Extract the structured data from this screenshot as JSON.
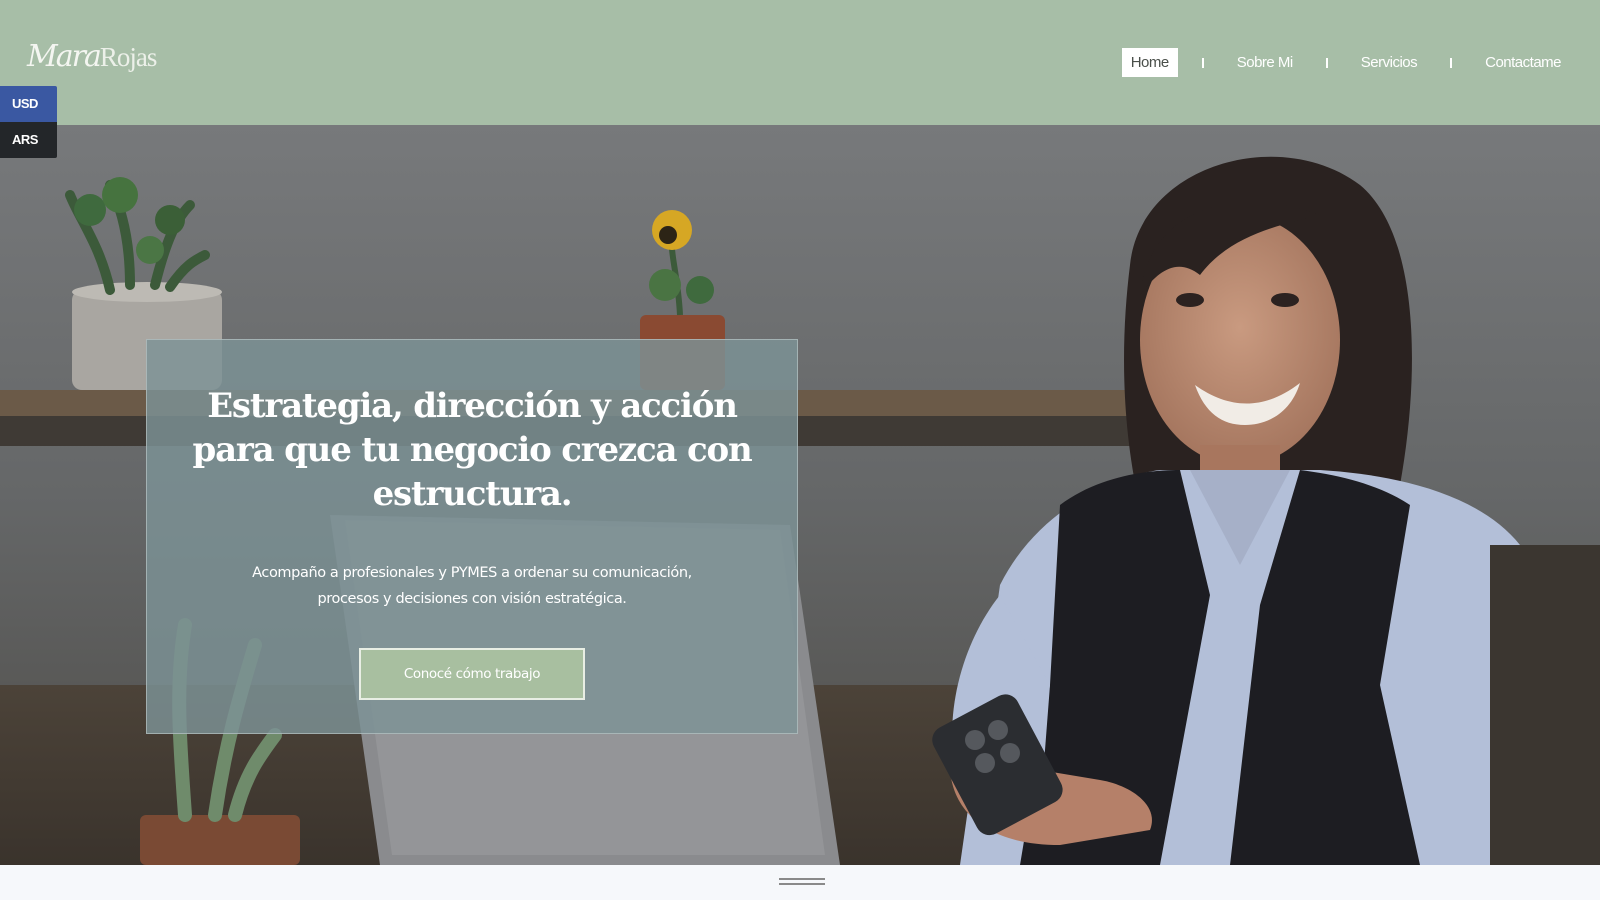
{
  "brand": {
    "logo_part1": "Mara",
    "logo_part2": "Rojas"
  },
  "nav": {
    "items": [
      {
        "label": "Home",
        "active": true
      },
      {
        "label": "Sobre Mi",
        "active": false
      },
      {
        "label": "Servicios",
        "active": false
      },
      {
        "label": "Contactame",
        "active": false
      }
    ]
  },
  "currency": {
    "usd": "USD",
    "ars": "ARS",
    "selected": "USD"
  },
  "hero": {
    "title": "Estrategia, dirección y acción para que tu negocio crezca con estructura.",
    "subtitle": "Acompaño a profesionales y PYMES a ordenar su comunicación, procesos y decisiones con visión estratégica.",
    "cta_label": "Conocé cómo trabajo"
  },
  "colors": {
    "header_bg": "#a7bea7",
    "usd_bg": "#3a58a2",
    "ars_bg": "#232629",
    "card_bg": "#7c9296",
    "cta_bg": "#a8bfa0"
  },
  "icons": {
    "scroll_handle": "drag-handle-icon"
  }
}
